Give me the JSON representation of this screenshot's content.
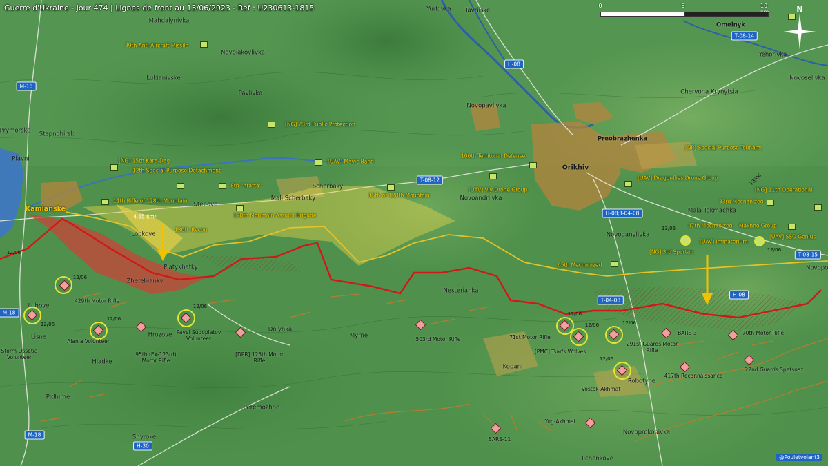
{
  "title": "Guerre d'Ukraine - Jour 474 | Lignes de front au 13/06/2023 - Ref : U230613-1815",
  "scale_bar": {
    "start": "0",
    "mid": "5",
    "end": "10 km"
  },
  "north_label": "N",
  "credit": "@Pouletvolant3",
  "area_label": "4.65 km²",
  "colors": {
    "front_line_red": "#d01818",
    "front_line_yellow": "#e3c22a",
    "ukrainian_gain": "#e3d24b",
    "russian_zone": "#c0483a",
    "road_badge": "#1d64c4",
    "unit_label": "#f2c200",
    "water": "#3f79b9"
  },
  "towns": [
    {
      "name": "Mahdalynivka"
    },
    {
      "name": "Novoiakovlivka"
    },
    {
      "name": "Lukianivske"
    },
    {
      "name": "Pavlivka"
    },
    {
      "name": "Prymorske"
    },
    {
      "name": "Stepnohirsk"
    },
    {
      "name": "Plavni"
    },
    {
      "name": "Kamianske",
      "big": true
    },
    {
      "name": "Stepove"
    },
    {
      "name": "Mali Scherbaky"
    },
    {
      "name": "Scherbaky"
    },
    {
      "name": "Lobkove"
    },
    {
      "name": "Piatykhatky"
    },
    {
      "name": "Zherebianky"
    },
    {
      "name": "Luhove"
    },
    {
      "name": "Lisne"
    },
    {
      "name": "Hrozove"
    },
    {
      "name": "Dolynka"
    },
    {
      "name": "Myrne"
    },
    {
      "name": "Hladke"
    },
    {
      "name": "Pidhirne"
    },
    {
      "name": "Peremozhne"
    },
    {
      "name": "Shyroke"
    },
    {
      "name": "Yurkivka"
    },
    {
      "name": "Tavriiske"
    },
    {
      "name": "Novopavlivka"
    },
    {
      "name": "Novoandriivka"
    },
    {
      "name": "Nesterianka"
    },
    {
      "name": "Kopani"
    },
    {
      "name": "Orikhiv",
      "big": true
    },
    {
      "name": "Preobrazhenka"
    },
    {
      "name": "Chervona Krynytsia"
    },
    {
      "name": "Omelnyk"
    },
    {
      "name": "Yehorivka"
    },
    {
      "name": "Novoselivka"
    },
    {
      "name": "Mala Tokmachka"
    },
    {
      "name": "Novodanylivka"
    },
    {
      "name": "Novopok"
    },
    {
      "name": "Robotyne"
    },
    {
      "name": "Novoprokopivka"
    },
    {
      "name": "Ilchenkove"
    }
  ],
  "roads": [
    {
      "label": "M-18"
    },
    {
      "label": "M-18"
    },
    {
      "label": "M-18"
    },
    {
      "label": "H-08"
    },
    {
      "label": "T-08-12"
    },
    {
      "label": "T-08-14"
    },
    {
      "label": "H-08;T-04-08"
    },
    {
      "label": "T-08-15"
    },
    {
      "label": "T-04-08"
    },
    {
      "label": "H-08"
    },
    {
      "label": "H-30"
    }
  ],
  "ukr_units": [
    {
      "label": "39th Anti-Aircraft Missile"
    },
    {
      "label": "[NG] 23rd Public Protection"
    },
    {
      "label": "[NG] 15th Kara-Dag"
    },
    {
      "label": "12th Special Purpose Detachment"
    },
    {
      "label": "8th \"Aratta\""
    },
    {
      "label": "[UAV] Mavic Band"
    },
    {
      "label": "11th Rifle of 128th Mountain"
    },
    {
      "label": "15th of 128th Mountain"
    },
    {
      "label": "128th Mountain Assault Brigade"
    },
    {
      "label": "130th Recon"
    },
    {
      "label": "106th Territorial Defense"
    },
    {
      "label": "[UAV] Viy Drone Group"
    },
    {
      "label": "[UAV] Dragonflies Drone Group"
    },
    {
      "label": "[NP] Special Purpose Tsunami"
    },
    {
      "label": "[NG] 11th Operational"
    },
    {
      "label": "33rd Mechanized"
    },
    {
      "label": "47th Mechanized"
    },
    {
      "label": "Makhno Group"
    },
    {
      "label": "[UAV] SSO Genius"
    },
    {
      "label": "[UAV] Immaterium"
    },
    {
      "label": "[NG] 3rd Spartan"
    },
    {
      "label": "65th Mechanized"
    }
  ],
  "ru_units": [
    {
      "label": "429th Motor Rifle"
    },
    {
      "label": "Storm Ossetia\nVolunteer"
    },
    {
      "label": "Alania Volunteer"
    },
    {
      "label": "95th (Ex-123rd)\nMotor Rifle"
    },
    {
      "label": "Pavel Sudoplatov\nVolunteer"
    },
    {
      "label": "[DPR] 125th Motor\nRifle"
    },
    {
      "label": "503rd Motor Rifle"
    },
    {
      "label": "71st Motor Rifle"
    },
    {
      "label": "[PMC] Tsar's Wolves"
    },
    {
      "label": "291st Guards Motor\nRifle"
    },
    {
      "label": "BARS-3"
    },
    {
      "label": "70th Motor Rifle"
    },
    {
      "label": "417th Reconnaissance"
    },
    {
      "label": "22nd Guards Spetsnaz"
    },
    {
      "label": "Vostok-Akhmat"
    },
    {
      "label": "Yug-Akhmat"
    },
    {
      "label": "BARS-11"
    }
  ],
  "dates": [
    "12/06",
    "12/06",
    "12/06",
    "12/06",
    "12/06",
    "12/06",
    "12/06",
    "12/06",
    "12/06",
    "13/06",
    "12/06",
    "13/06"
  ]
}
